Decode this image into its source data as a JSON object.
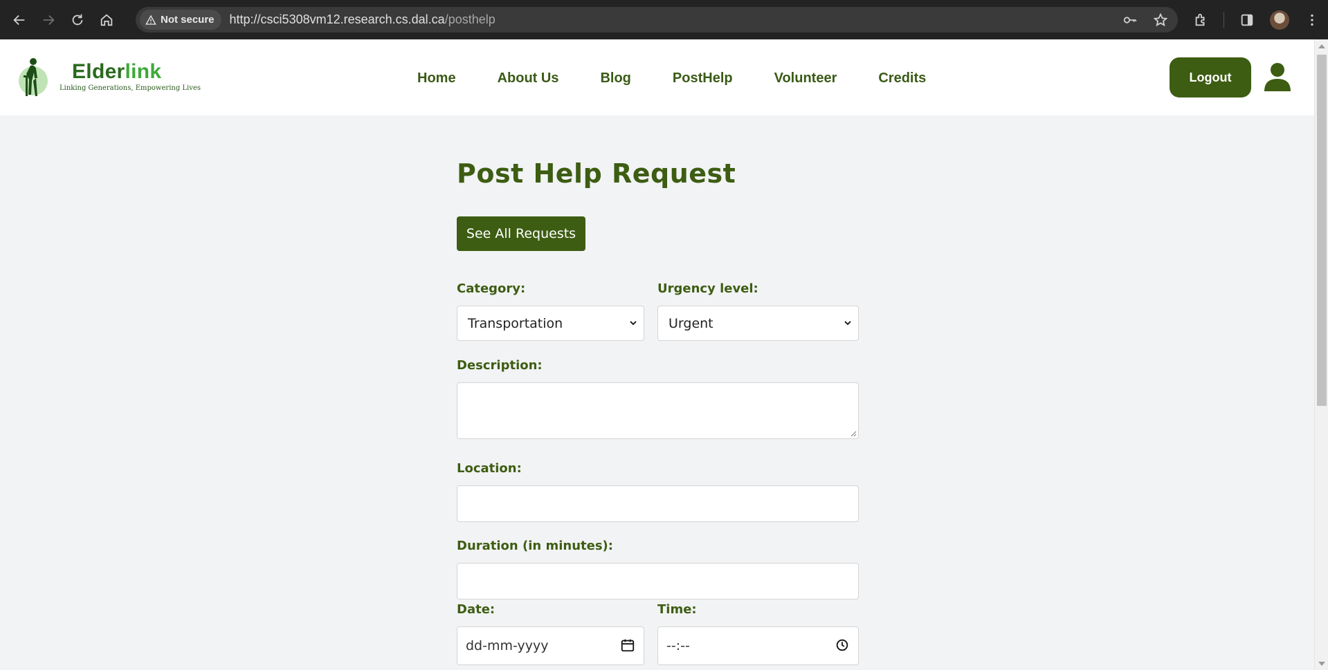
{
  "browser": {
    "security_label": "Not secure",
    "url_host": "http://csci5308vm12.research.cs.dal.ca",
    "url_path": "/posthelp"
  },
  "site": {
    "logo_name_a": "Elder",
    "logo_name_b": "link",
    "tagline": "Linking Generations, Empowering Lives",
    "nav": [
      "Home",
      "About Us",
      "Blog",
      "PostHelp",
      "Volunteer",
      "Credits"
    ],
    "logout_label": "Logout"
  },
  "form": {
    "title": "Post Help Request",
    "see_all_label": "See All Requests",
    "category_label": "Category:",
    "category_value": "Transportation",
    "urgency_label": "Urgency level:",
    "urgency_value": "Urgent",
    "description_label": "Description:",
    "location_label": "Location:",
    "duration_label": "Duration (in minutes):",
    "date_label": "Date:",
    "date_placeholder": "dd-mm-yyyy",
    "time_label": "Time:",
    "time_placeholder": "--:--"
  },
  "colors": {
    "brand_green": "#3d5d12",
    "chrome_bg": "#232323",
    "page_bg": "#f2f3f5"
  }
}
